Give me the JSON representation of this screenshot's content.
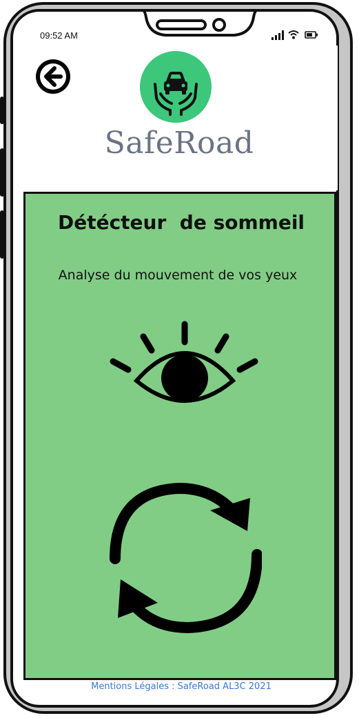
{
  "status_bar": {
    "time": "09:52 AM",
    "icons": [
      "signal-icon",
      "wifi-icon",
      "battery-icon"
    ]
  },
  "header": {
    "back_icon": "arrow-left-circle-icon",
    "logo_icon": "car-hands-icon",
    "brand_name": "SafeRoad"
  },
  "main": {
    "title": "Détécteur  de sommeil",
    "subtitle": "Analyse du mouvement de vos yeux",
    "eye_icon": "eye-icon",
    "refresh_icon": "refresh-icon"
  },
  "footer": {
    "text": "Mentions Légales : SafeRoad AL3C 2021"
  },
  "colors": {
    "panel_bg": "#82cd86",
    "logo_bg": "#3cc77b",
    "brand_text": "#6a7384",
    "footer_link": "#3c78d8",
    "frame": "#c6c6c6"
  }
}
